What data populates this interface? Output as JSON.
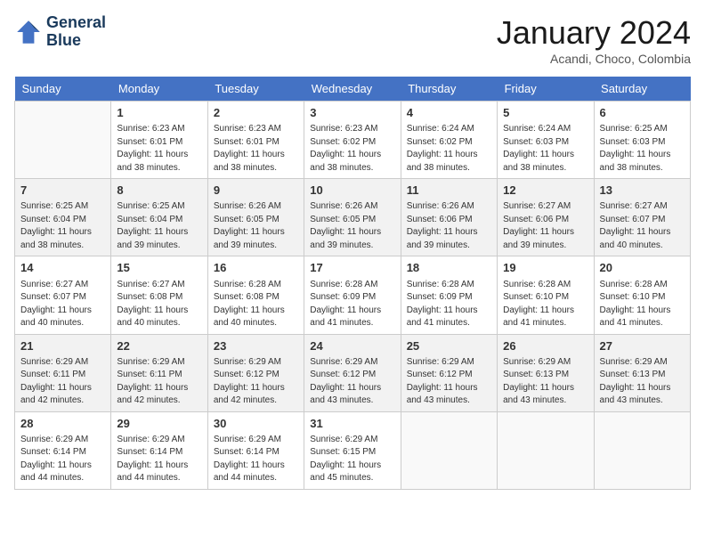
{
  "logo": {
    "line1": "General",
    "line2": "Blue"
  },
  "title": "January 2024",
  "location": "Acandi, Choco, Colombia",
  "days_of_week": [
    "Sunday",
    "Monday",
    "Tuesday",
    "Wednesday",
    "Thursday",
    "Friday",
    "Saturday"
  ],
  "weeks": [
    [
      {
        "day": "",
        "info": ""
      },
      {
        "day": "1",
        "info": "Sunrise: 6:23 AM\nSunset: 6:01 PM\nDaylight: 11 hours\nand 38 minutes."
      },
      {
        "day": "2",
        "info": "Sunrise: 6:23 AM\nSunset: 6:01 PM\nDaylight: 11 hours\nand 38 minutes."
      },
      {
        "day": "3",
        "info": "Sunrise: 6:23 AM\nSunset: 6:02 PM\nDaylight: 11 hours\nand 38 minutes."
      },
      {
        "day": "4",
        "info": "Sunrise: 6:24 AM\nSunset: 6:02 PM\nDaylight: 11 hours\nand 38 minutes."
      },
      {
        "day": "5",
        "info": "Sunrise: 6:24 AM\nSunset: 6:03 PM\nDaylight: 11 hours\nand 38 minutes."
      },
      {
        "day": "6",
        "info": "Sunrise: 6:25 AM\nSunset: 6:03 PM\nDaylight: 11 hours\nand 38 minutes."
      }
    ],
    [
      {
        "day": "7",
        "info": "Sunrise: 6:25 AM\nSunset: 6:04 PM\nDaylight: 11 hours\nand 38 minutes."
      },
      {
        "day": "8",
        "info": "Sunrise: 6:25 AM\nSunset: 6:04 PM\nDaylight: 11 hours\nand 39 minutes."
      },
      {
        "day": "9",
        "info": "Sunrise: 6:26 AM\nSunset: 6:05 PM\nDaylight: 11 hours\nand 39 minutes."
      },
      {
        "day": "10",
        "info": "Sunrise: 6:26 AM\nSunset: 6:05 PM\nDaylight: 11 hours\nand 39 minutes."
      },
      {
        "day": "11",
        "info": "Sunrise: 6:26 AM\nSunset: 6:06 PM\nDaylight: 11 hours\nand 39 minutes."
      },
      {
        "day": "12",
        "info": "Sunrise: 6:27 AM\nSunset: 6:06 PM\nDaylight: 11 hours\nand 39 minutes."
      },
      {
        "day": "13",
        "info": "Sunrise: 6:27 AM\nSunset: 6:07 PM\nDaylight: 11 hours\nand 40 minutes."
      }
    ],
    [
      {
        "day": "14",
        "info": "Sunrise: 6:27 AM\nSunset: 6:07 PM\nDaylight: 11 hours\nand 40 minutes."
      },
      {
        "day": "15",
        "info": "Sunrise: 6:27 AM\nSunset: 6:08 PM\nDaylight: 11 hours\nand 40 minutes."
      },
      {
        "day": "16",
        "info": "Sunrise: 6:28 AM\nSunset: 6:08 PM\nDaylight: 11 hours\nand 40 minutes."
      },
      {
        "day": "17",
        "info": "Sunrise: 6:28 AM\nSunset: 6:09 PM\nDaylight: 11 hours\nand 41 minutes."
      },
      {
        "day": "18",
        "info": "Sunrise: 6:28 AM\nSunset: 6:09 PM\nDaylight: 11 hours\nand 41 minutes."
      },
      {
        "day": "19",
        "info": "Sunrise: 6:28 AM\nSunset: 6:10 PM\nDaylight: 11 hours\nand 41 minutes."
      },
      {
        "day": "20",
        "info": "Sunrise: 6:28 AM\nSunset: 6:10 PM\nDaylight: 11 hours\nand 41 minutes."
      }
    ],
    [
      {
        "day": "21",
        "info": "Sunrise: 6:29 AM\nSunset: 6:11 PM\nDaylight: 11 hours\nand 42 minutes."
      },
      {
        "day": "22",
        "info": "Sunrise: 6:29 AM\nSunset: 6:11 PM\nDaylight: 11 hours\nand 42 minutes."
      },
      {
        "day": "23",
        "info": "Sunrise: 6:29 AM\nSunset: 6:12 PM\nDaylight: 11 hours\nand 42 minutes."
      },
      {
        "day": "24",
        "info": "Sunrise: 6:29 AM\nSunset: 6:12 PM\nDaylight: 11 hours\nand 43 minutes."
      },
      {
        "day": "25",
        "info": "Sunrise: 6:29 AM\nSunset: 6:12 PM\nDaylight: 11 hours\nand 43 minutes."
      },
      {
        "day": "26",
        "info": "Sunrise: 6:29 AM\nSunset: 6:13 PM\nDaylight: 11 hours\nand 43 minutes."
      },
      {
        "day": "27",
        "info": "Sunrise: 6:29 AM\nSunset: 6:13 PM\nDaylight: 11 hours\nand 43 minutes."
      }
    ],
    [
      {
        "day": "28",
        "info": "Sunrise: 6:29 AM\nSunset: 6:14 PM\nDaylight: 11 hours\nand 44 minutes."
      },
      {
        "day": "29",
        "info": "Sunrise: 6:29 AM\nSunset: 6:14 PM\nDaylight: 11 hours\nand 44 minutes."
      },
      {
        "day": "30",
        "info": "Sunrise: 6:29 AM\nSunset: 6:14 PM\nDaylight: 11 hours\nand 44 minutes."
      },
      {
        "day": "31",
        "info": "Sunrise: 6:29 AM\nSunset: 6:15 PM\nDaylight: 11 hours\nand 45 minutes."
      },
      {
        "day": "",
        "info": ""
      },
      {
        "day": "",
        "info": ""
      },
      {
        "day": "",
        "info": ""
      }
    ]
  ]
}
